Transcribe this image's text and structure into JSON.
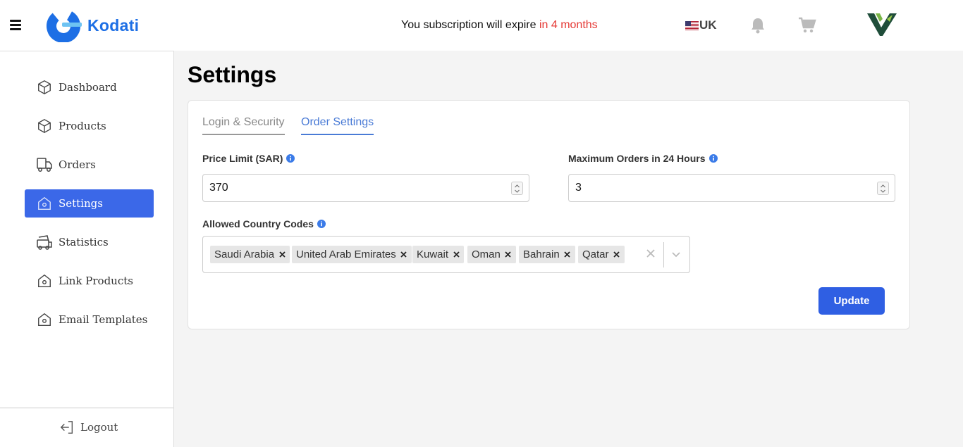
{
  "header": {
    "logo_text": "Kodati",
    "subscription_prefix": "You subscription will expire ",
    "subscription_highlight": "in 4 months",
    "language": "UK"
  },
  "sidebar": {
    "items": [
      {
        "label": "Dashboard",
        "icon": "cube-icon",
        "active": false
      },
      {
        "label": "Products",
        "icon": "cube-icon",
        "active": false
      },
      {
        "label": "Orders",
        "icon": "truck-icon",
        "active": false
      },
      {
        "label": "Settings",
        "icon": "home-icon",
        "active": true
      },
      {
        "label": "Statistics",
        "icon": "delivery-icon",
        "active": false
      },
      {
        "label": "Link Products",
        "icon": "home-icon",
        "active": false
      },
      {
        "label": "Email Templates",
        "icon": "home-icon",
        "active": false
      }
    ],
    "logout_label": "Logout"
  },
  "main": {
    "title": "Settings",
    "tabs": [
      {
        "label": "Login & Security",
        "active": false
      },
      {
        "label": "Order Settings",
        "active": true
      }
    ],
    "price_limit": {
      "label": "Price Limit (SAR)",
      "value": "370"
    },
    "max_orders": {
      "label": "Maximum Orders in 24 Hours",
      "value": "3"
    },
    "country_codes": {
      "label": "Allowed Country Codes",
      "selected": [
        "Saudi Arabia",
        "United Arab Emirates",
        "Kuwait",
        "Oman",
        "Bahrain",
        "Qatar"
      ]
    },
    "update_label": "Update"
  },
  "colors": {
    "accent": "#3b68e8",
    "brand": "#1d6fe5",
    "warning_text": "#e53935",
    "tab_active": "#4a7bd6"
  }
}
